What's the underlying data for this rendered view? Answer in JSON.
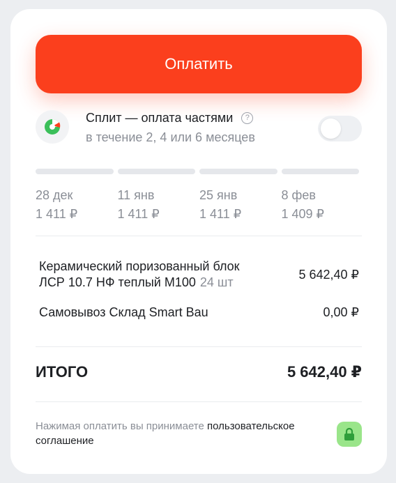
{
  "pay_button": {
    "label": "Оплатить"
  },
  "split": {
    "title": "Сплит — оплата частями",
    "help": "?",
    "subtitle": "в течение 2, 4 или 6 месяцев",
    "enabled": false
  },
  "schedule": [
    {
      "date": "28 дек",
      "amount": "1 411 ₽"
    },
    {
      "date": "11 янв",
      "amount": "1 411 ₽"
    },
    {
      "date": "25 янв",
      "amount": "1 411 ₽"
    },
    {
      "date": "8 фев",
      "amount": "1 409 ₽"
    }
  ],
  "items": [
    {
      "name_line1": "Керамический поризованный блок",
      "name_line2": "ЛСР 10.7 НФ теплый М100",
      "qty": "24 шт",
      "price": "5 642,40 ₽"
    },
    {
      "name": "Самовывоз Склад Smart Bau",
      "price": "0,00 ₽"
    }
  ],
  "total": {
    "label": "ИТОГО",
    "value": "5 642,40 ₽"
  },
  "footer": {
    "text": "Нажимая оплатить вы принимаете ",
    "link": "пользовательское соглашение"
  },
  "colors": {
    "accent": "#fb3f1d",
    "lock_bg": "#9ae58a",
    "muted_text": "#8a8e96"
  },
  "icons": {
    "split_logo": "split-logo-icon",
    "help": "question-circle-icon",
    "lock": "lock-icon"
  }
}
